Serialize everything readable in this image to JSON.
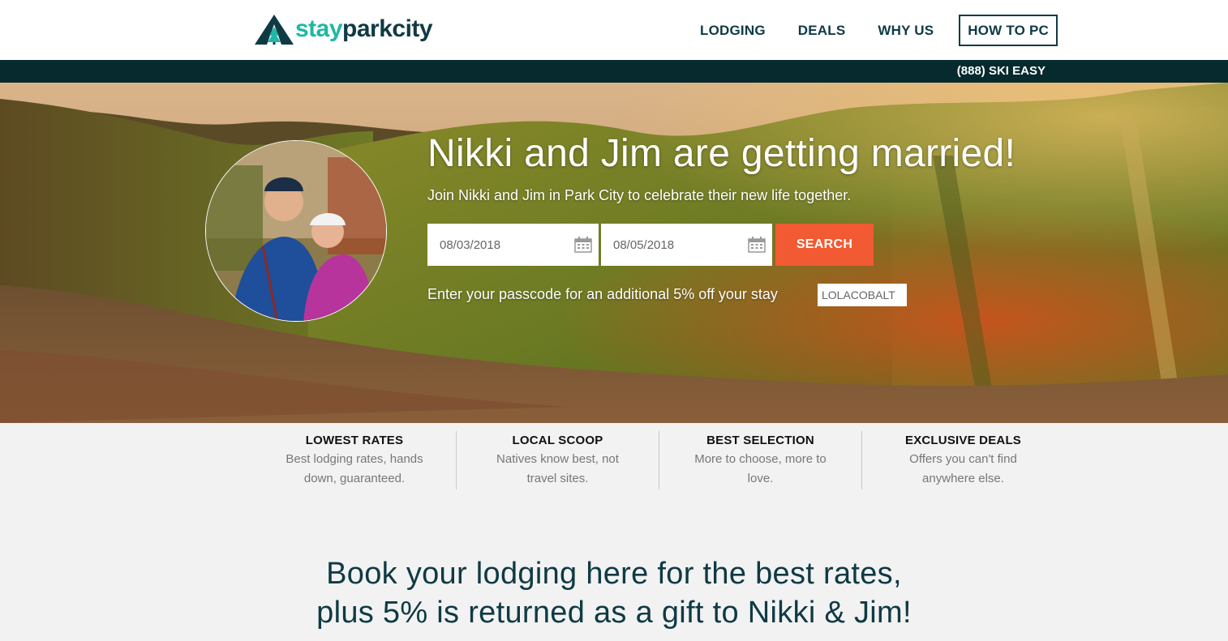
{
  "brand": {
    "part1": "stay",
    "part2": "parkcity",
    "accent": "#1fb7a6",
    "dark": "#0f3a44"
  },
  "nav": [
    {
      "label": "LODGING"
    },
    {
      "label": "DEALS"
    },
    {
      "label": "WHY US"
    },
    {
      "label": "HOW TO PC"
    }
  ],
  "phone": "(888) SKI EASY",
  "hero": {
    "title": "Nikki and Jim are getting married!",
    "subtitle": "Join Nikki and Jim in Park City to celebrate their new life together.",
    "checkin": "08/03/2018",
    "checkout": "08/05/2018",
    "search_label": "SEARCH",
    "passcode_label": "Enter your passcode for an additional 5% off your stay",
    "passcode_value": "LOLACOBALT",
    "search_color": "#f15a32"
  },
  "features": [
    {
      "title": "LOWEST RATES",
      "text": "Best lodging rates, hands down, guaranteed."
    },
    {
      "title": "LOCAL SCOOP",
      "text": "Natives know best, not travel sites."
    },
    {
      "title": "BEST SELECTION",
      "text": "More to choose, more to love."
    },
    {
      "title": "EXCLUSIVE DEALS",
      "text": "Offers you can't find anywhere else."
    }
  ],
  "book": {
    "line1": "Book your lodging here for the best rates,",
    "line2": "plus 5% is returned as a gift to Nikki & Jim!"
  }
}
